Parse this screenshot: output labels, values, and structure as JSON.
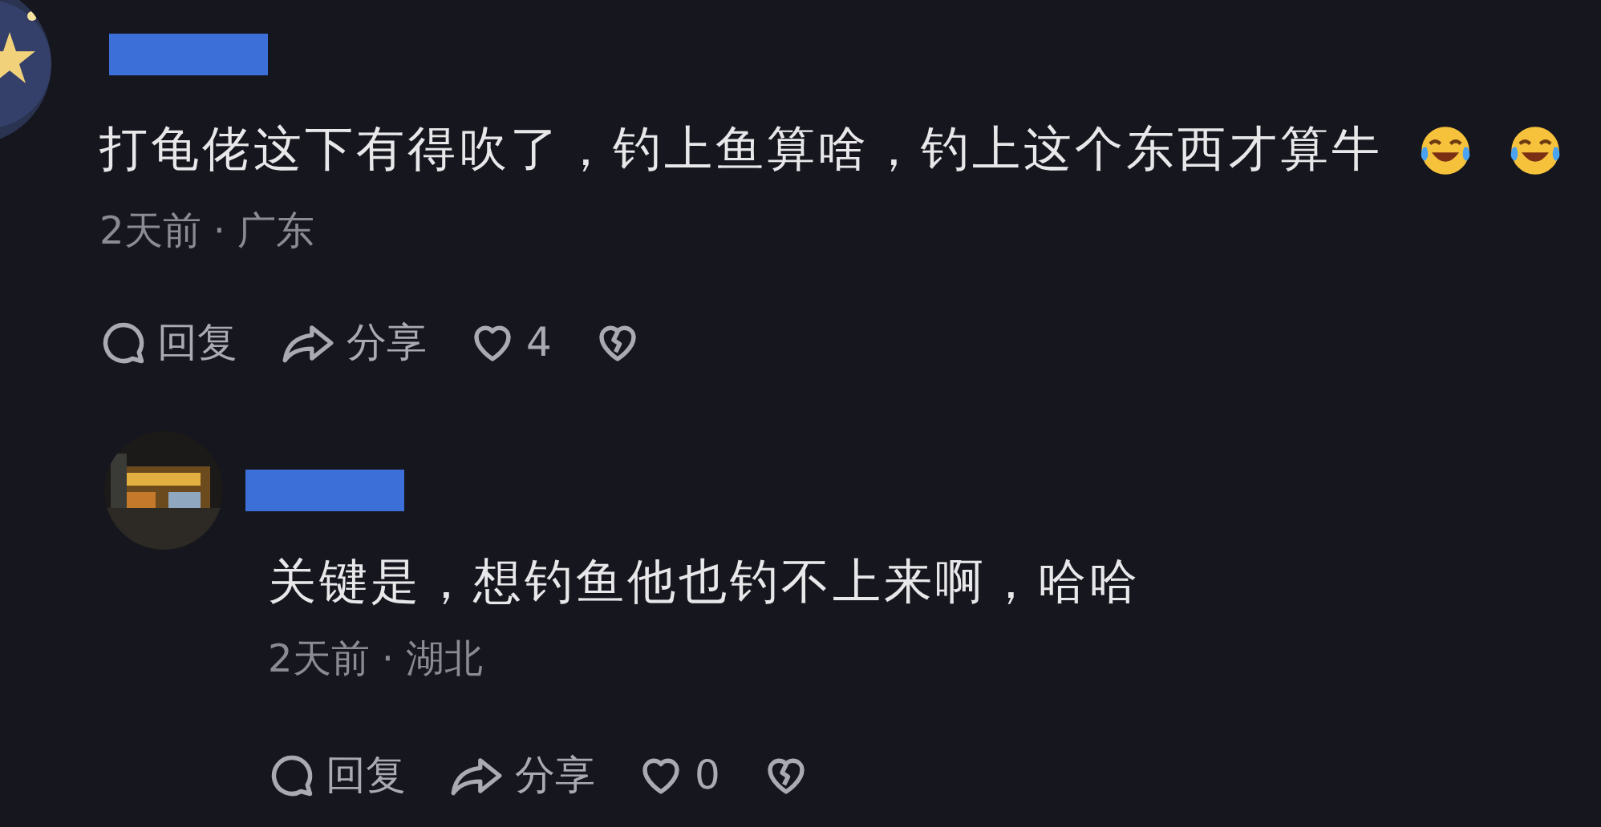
{
  "comments": [
    {
      "kind": "top",
      "content": [
        {
          "kind": "text",
          "text": "打龟佬这下有得吹了，钓上鱼算啥，钓上这个东西才算牛"
        },
        {
          "kind": "emoji"
        },
        {
          "kind": "emoji"
        }
      ],
      "meta": "2天前 · 广东",
      "reply_label": "回复",
      "share_label": "分享",
      "likes": "4"
    },
    {
      "kind": "reply",
      "content": [
        {
          "kind": "text",
          "text": "关键是，想钓鱼他也钓不上来啊，哈哈"
        }
      ],
      "meta": "2天前 · 湖北",
      "reply_label": "回复",
      "share_label": "分享",
      "likes": "0"
    }
  ]
}
